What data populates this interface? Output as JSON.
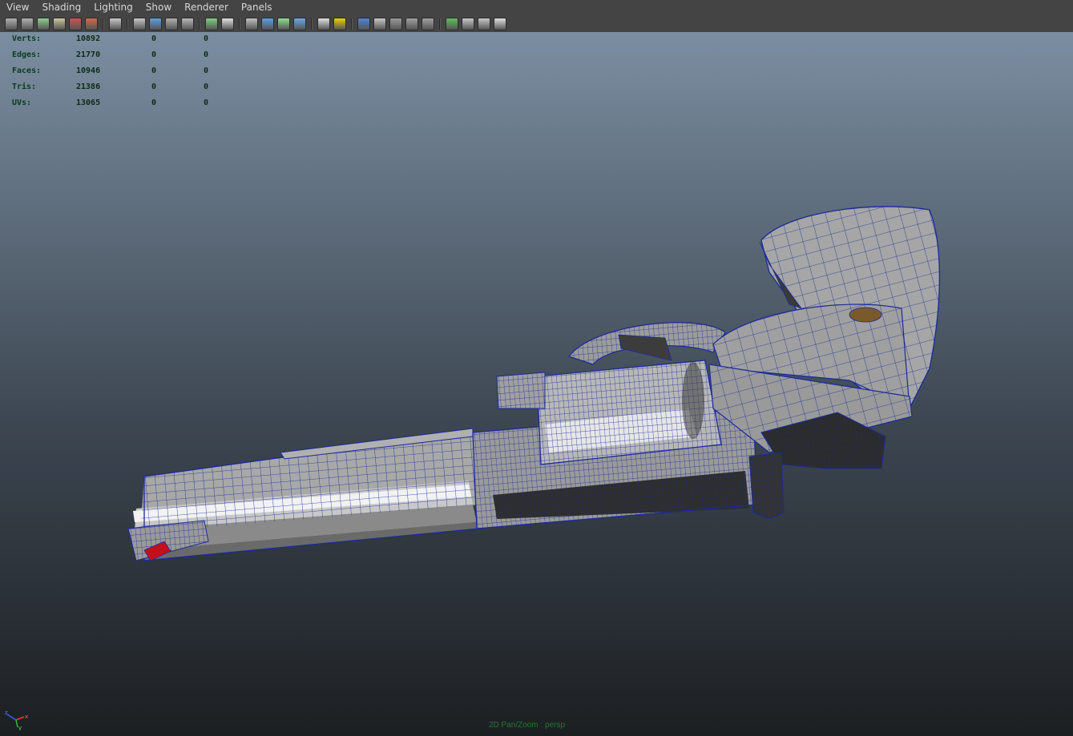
{
  "menu": {
    "items": [
      "View",
      "Shading",
      "Lighting",
      "Show",
      "Renderer",
      "Panels"
    ]
  },
  "toolbar": {
    "icons": [
      {
        "name": "camera-select-icon",
        "color": "#b0b0b0"
      },
      {
        "name": "camera-attributes-icon",
        "color": "#b0b0b0"
      },
      {
        "name": "bookmarks-icon",
        "color": "#8fcf8f"
      },
      {
        "name": "image-plane-icon",
        "color": "#c8c89a"
      },
      {
        "name": "grease-pencil-icon",
        "color": "#d05050"
      },
      {
        "name": "two-d-pan-zoom-icon",
        "color": "#d06a4a"
      },
      {
        "name": "grid-icon",
        "color": "#c8c8c8"
      },
      {
        "name": "film-gate-icon",
        "color": "#c8c8c8"
      },
      {
        "name": "resolution-gate-icon",
        "color": "#5aa0e0"
      },
      {
        "name": "gate-mask-icon",
        "color": "#b0b0b0"
      },
      {
        "name": "field-chart-icon",
        "color": "#b8b8b8"
      },
      {
        "name": "safe-action-icon",
        "color": "#7fcf7f"
      },
      {
        "name": "safe-title-icon",
        "color": "#e0e0e0"
      },
      {
        "name": "wireframe-icon",
        "color": "#c0c0c0"
      },
      {
        "name": "smooth-shade-icon",
        "color": "#5a9ee6"
      },
      {
        "name": "wireframe-on-shaded-icon",
        "color": "#8fdf8f"
      },
      {
        "name": "xray-icon",
        "color": "#6aa8e8"
      },
      {
        "name": "textured-icon",
        "color": "#e0e0e0"
      },
      {
        "name": "default-light-icon",
        "color": "#e8d200"
      },
      {
        "name": "shadows-icon",
        "color": "#4d84d8"
      },
      {
        "name": "screen-space-ao-icon",
        "color": "#c8c8c8"
      },
      {
        "name": "motion-blur-icon",
        "color": "#9a9a9a"
      },
      {
        "name": "anti-aliasing-icon",
        "color": "#a0a0a0"
      },
      {
        "name": "depth-of-field-icon",
        "color": "#a0a0a0"
      },
      {
        "name": "isolate-select-icon",
        "color": "#5fbf5f"
      },
      {
        "name": "xray-joints-icon",
        "color": "#c8c8c8"
      },
      {
        "name": "xray-components-icon",
        "color": "#c8c8c8"
      },
      {
        "name": "share-view-icon",
        "color": "#e0e0e0"
      }
    ]
  },
  "hud": {
    "rows": [
      {
        "label": "Verts:",
        "v1": "10892",
        "v2": "0",
        "v3": "0"
      },
      {
        "label": "Edges:",
        "v1": "21770",
        "v2": "0",
        "v3": "0"
      },
      {
        "label": "Faces:",
        "v1": "10946",
        "v2": "0",
        "v3": "0"
      },
      {
        "label": "Tris:",
        "v1": "21386",
        "v2": "0",
        "v3": "0"
      },
      {
        "label": "UVs:",
        "v1": "13065",
        "v2": "0",
        "v3": "0"
      }
    ]
  },
  "viewport": {
    "camera_label": "2D Pan/Zoom : persp",
    "axis_labels": {
      "x": "x",
      "y": "y",
      "z": "z"
    },
    "mesh_name": "revolver-mesh",
    "colors": {
      "wire": "#1a2a9a",
      "mesh_light": "#c8c8c8",
      "mesh_mid": "#8c8c8c",
      "mesh_dark": "#3a3a3a",
      "sight": "#c4101c",
      "grip_screw": "#7a5a2a"
    }
  }
}
